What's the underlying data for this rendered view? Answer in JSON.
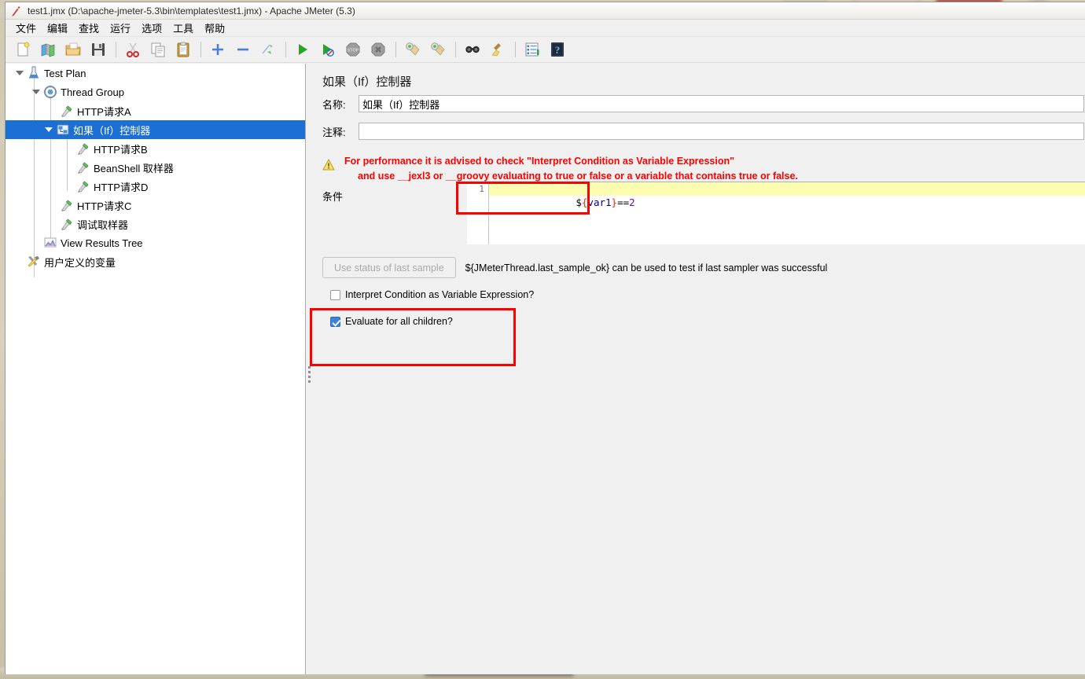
{
  "window": {
    "title": "test1.jmx (D:\\apache-jmeter-5.3\\bin\\templates\\test1.jmx) - Apache JMeter (5.3)",
    "app_icon": "jmeter-feather-icon"
  },
  "menubar": {
    "items": [
      {
        "label": "文件",
        "name": "menu-file"
      },
      {
        "label": "编辑",
        "name": "menu-edit"
      },
      {
        "label": "查找",
        "name": "menu-search"
      },
      {
        "label": "运行",
        "name": "menu-run"
      },
      {
        "label": "选项",
        "name": "menu-options"
      },
      {
        "label": "工具",
        "name": "menu-tools"
      },
      {
        "label": "帮助",
        "name": "menu-help"
      }
    ]
  },
  "toolbar": {
    "items": [
      {
        "name": "new-icon",
        "title": "New"
      },
      {
        "name": "templates-icon",
        "title": "Templates"
      },
      {
        "name": "open-icon",
        "title": "Open"
      },
      {
        "name": "save-icon",
        "title": "Save"
      },
      {
        "sep": true
      },
      {
        "name": "cut-icon",
        "title": "Cut"
      },
      {
        "name": "copy-icon",
        "title": "Copy"
      },
      {
        "name": "paste-icon",
        "title": "Paste"
      },
      {
        "sep": true
      },
      {
        "name": "expand-all-icon",
        "title": "Expand All"
      },
      {
        "name": "collapse-all-icon",
        "title": "Collapse All"
      },
      {
        "name": "toggle-icon",
        "title": "Toggle"
      },
      {
        "sep": true
      },
      {
        "name": "start-icon",
        "title": "Start"
      },
      {
        "name": "start-no-pauses-icon",
        "title": "Start no pauses"
      },
      {
        "name": "stop-icon",
        "title": "Stop"
      },
      {
        "name": "shutdown-icon",
        "title": "Shutdown"
      },
      {
        "sep": true
      },
      {
        "name": "clear-icon",
        "title": "Clear"
      },
      {
        "name": "clear-all-icon",
        "title": "Clear All"
      },
      {
        "sep": true
      },
      {
        "name": "search-icon",
        "title": "Search"
      },
      {
        "name": "reset-search-icon",
        "title": "Reset Search"
      },
      {
        "sep": true
      },
      {
        "name": "function-helper-icon",
        "title": "Function Helper Dialog"
      },
      {
        "name": "help-icon",
        "title": "Help"
      }
    ]
  },
  "tree": {
    "nodes": [
      {
        "label": "Test Plan",
        "depth": 0,
        "icon": "test-plan-icon",
        "twisty": "open",
        "selected": false,
        "name": "tree-node-test-plan"
      },
      {
        "label": "Thread Group",
        "depth": 1,
        "icon": "thread-group-icon",
        "twisty": "open",
        "selected": false,
        "name": "tree-node-thread-group"
      },
      {
        "label": "HTTP请求A",
        "depth": 2,
        "icon": "sampler-icon",
        "twisty": "none",
        "selected": false,
        "name": "tree-node-http-request-a"
      },
      {
        "label": "如果（If）控制器",
        "depth": 2,
        "icon": "if-controller-icon",
        "twisty": "open",
        "selected": true,
        "name": "tree-node-if-controller"
      },
      {
        "label": "HTTP请求B",
        "depth": 3,
        "icon": "sampler-icon",
        "twisty": "none",
        "selected": false,
        "name": "tree-node-http-request-b"
      },
      {
        "label": "BeanShell 取样器",
        "depth": 3,
        "icon": "sampler-icon",
        "twisty": "none",
        "selected": false,
        "name": "tree-node-beanshell-sampler"
      },
      {
        "label": "HTTP请求D",
        "depth": 3,
        "icon": "sampler-icon",
        "twisty": "none",
        "selected": false,
        "name": "tree-node-http-request-d"
      },
      {
        "label": "HTTP请求C",
        "depth": 2,
        "icon": "sampler-icon",
        "twisty": "none",
        "selected": false,
        "name": "tree-node-http-request-c"
      },
      {
        "label": "调试取样器",
        "depth": 2,
        "icon": "sampler-icon",
        "twisty": "none",
        "selected": false,
        "name": "tree-node-debug-sampler"
      },
      {
        "label": "View Results Tree",
        "depth": 1,
        "icon": "listener-icon",
        "twisty": "none",
        "selected": false,
        "name": "tree-node-view-results-tree"
      },
      {
        "label": "用户定义的变量",
        "depth": 1,
        "icon": "config-icon",
        "twisty": "none",
        "selected": false,
        "name": "tree-node-user-defined-variables"
      }
    ]
  },
  "panel": {
    "title": "如果（If）控制器",
    "name_label": "名称:",
    "name_value": "如果（If）控制器",
    "comment_label": "注释:",
    "comment_value": "",
    "warning_line1": "For performance it is advised to check \"Interpret Condition as Variable Expression\"",
    "warning_line2": "and use __jexl3 or __groovy evaluating to true or false or a variable that contains true or false.",
    "condition_label": "条件",
    "condition_line_number": "1",
    "condition_tokens": [
      {
        "t": "$",
        "cls": "tk-dollar"
      },
      {
        "t": "{",
        "cls": "tk-brace"
      },
      {
        "t": "var1",
        "cls": "tk-var"
      },
      {
        "t": "}",
        "cls": "tk-brace"
      },
      {
        "t": "==",
        "cls": "tk-op"
      },
      {
        "t": "2",
        "cls": "tk-num"
      }
    ],
    "condition_text": "${var1}==2",
    "use_status_button": "Use status of last sample",
    "status_hint": "${JMeterThread.last_sample_ok} can be used to test if last sampler was successful",
    "interpret_checkbox_label": "Interpret Condition as Variable Expression?",
    "interpret_checked": false,
    "evaluate_checkbox_label": "Evaluate for all children?",
    "evaluate_checked": true
  },
  "colors": {
    "selection_blue": "#1c6fd4",
    "annotation_red": "#ff0000",
    "warning_red": "#ff0000",
    "code_highlight_yellow": "#fdfdb2",
    "panel_gray": "#f0f0f0"
  }
}
